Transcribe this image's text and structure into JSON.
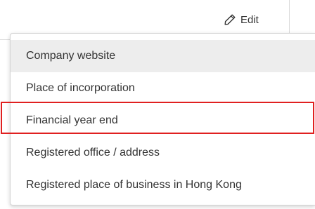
{
  "header": {
    "edit_label": "Edit",
    "edit_icon": "pencil-icon"
  },
  "menu": {
    "items": [
      {
        "label": "Company website",
        "state": "hovered"
      },
      {
        "label": "Place of incorporation",
        "state": "normal"
      },
      {
        "label": "Financial year end",
        "state": "highlighted"
      },
      {
        "label": "Registered office / address",
        "state": "normal"
      },
      {
        "label": "Registered place of business in Hong Kong",
        "state": "normal"
      }
    ]
  },
  "colors": {
    "highlight_border": "#e02020",
    "hover_background": "#ededed",
    "text": "#333333"
  }
}
